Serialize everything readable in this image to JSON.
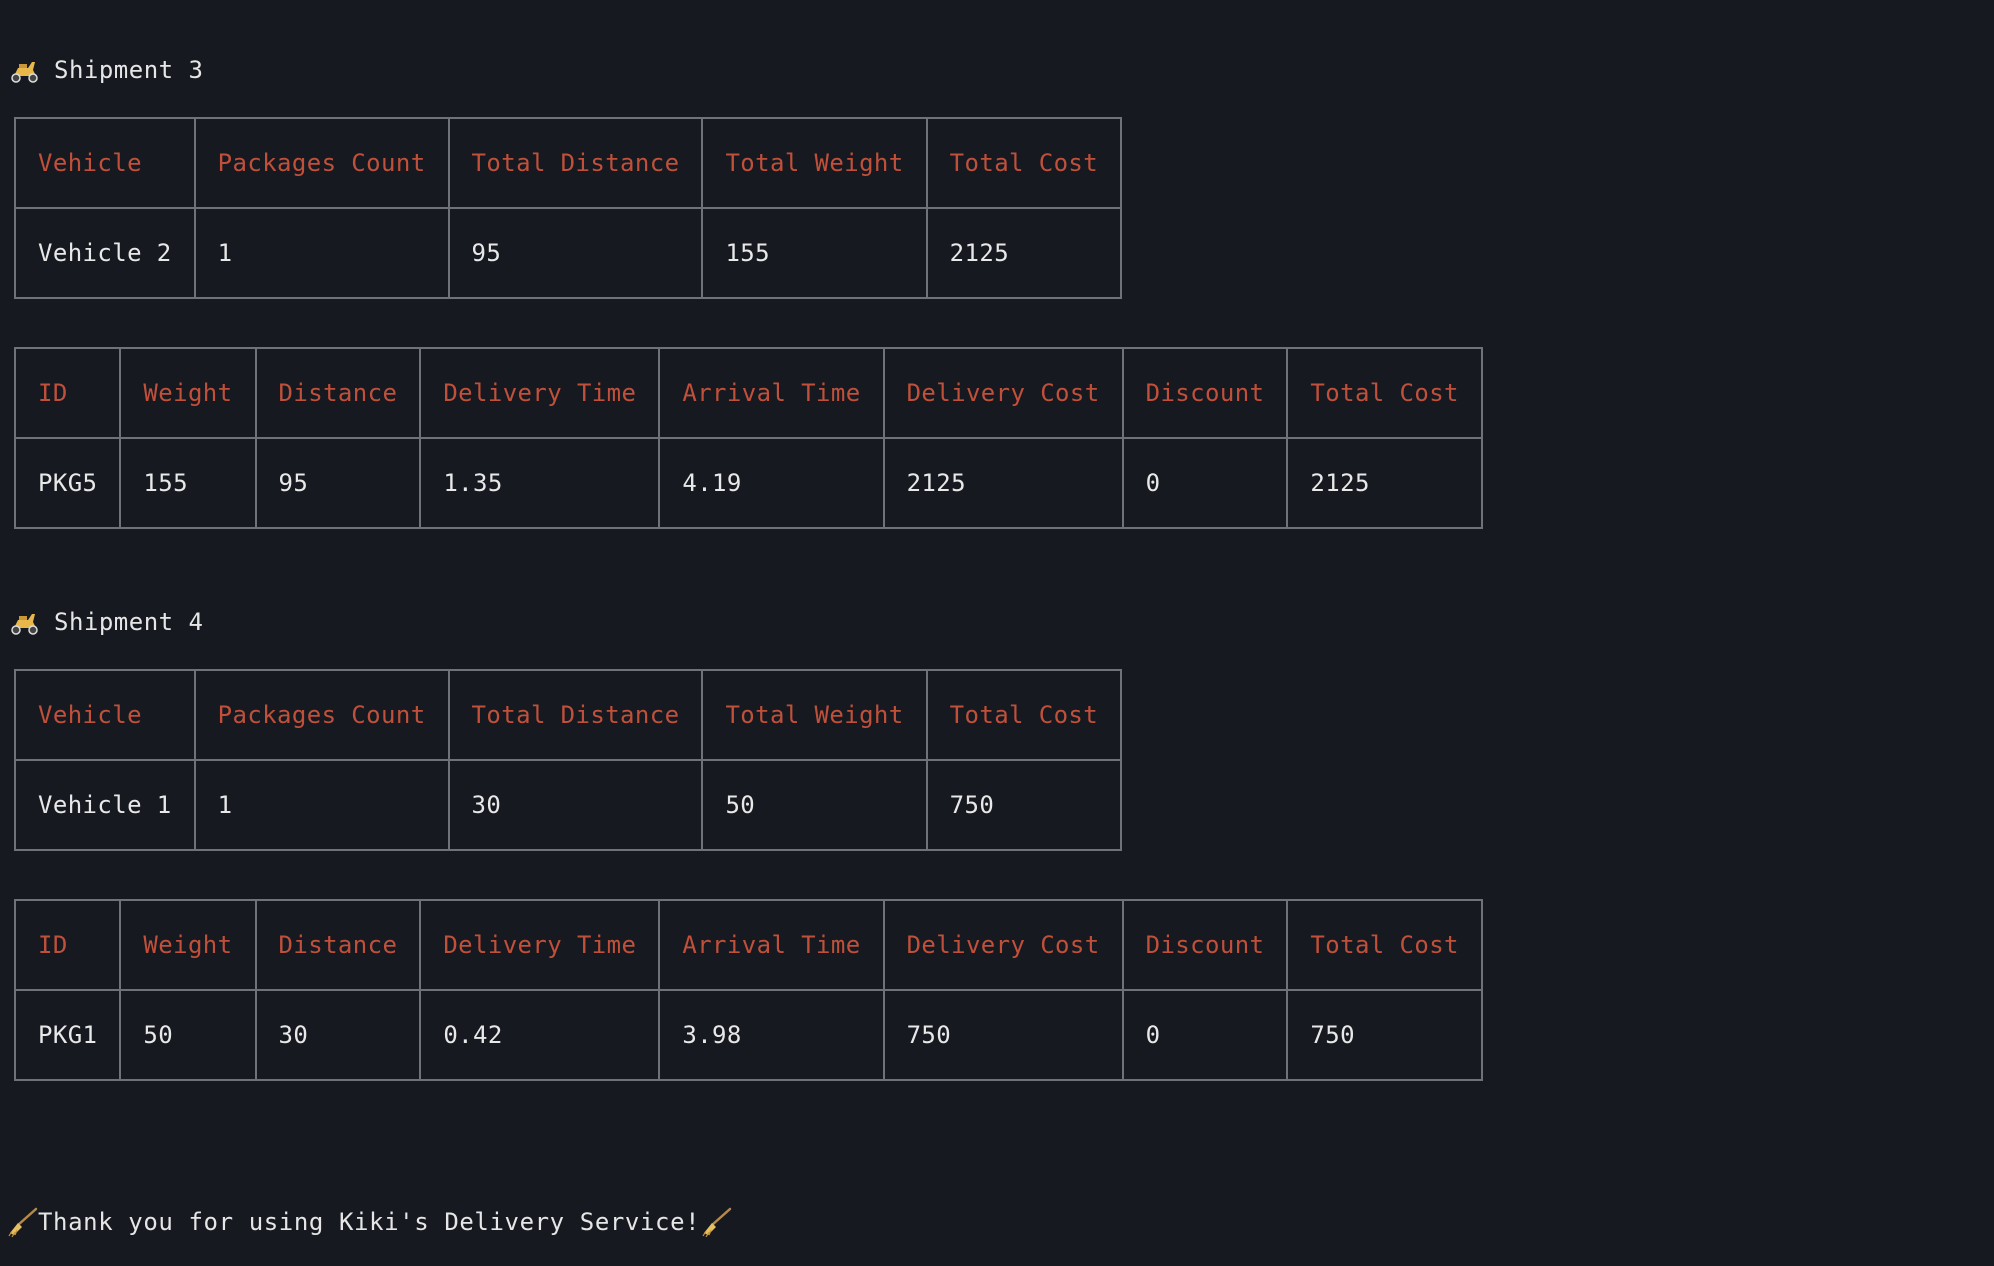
{
  "shipments": [
    {
      "title": "Shipment 3",
      "summary": {
        "headers": [
          "Vehicle",
          "Packages Count",
          "Total Distance",
          "Total Weight",
          "Total Cost"
        ],
        "row": [
          "Vehicle 2",
          "1",
          "95",
          "155",
          "2125"
        ]
      },
      "packages": {
        "headers": [
          "ID",
          "Weight",
          "Distance",
          "Delivery Time",
          "Arrival Time",
          "Delivery Cost",
          "Discount",
          "Total Cost"
        ],
        "rows": [
          [
            "PKG5",
            "155",
            "95",
            "1.35",
            "4.19",
            "2125",
            "0",
            "2125"
          ]
        ]
      }
    },
    {
      "title": "Shipment 4",
      "summary": {
        "headers": [
          "Vehicle",
          "Packages Count",
          "Total Distance",
          "Total Weight",
          "Total Cost"
        ],
        "row": [
          "Vehicle 1",
          "1",
          "30",
          "50",
          "750"
        ]
      },
      "packages": {
        "headers": [
          "ID",
          "Weight",
          "Distance",
          "Delivery Time",
          "Arrival Time",
          "Delivery Cost",
          "Discount",
          "Total Cost"
        ],
        "rows": [
          [
            "PKG1",
            "50",
            "30",
            "0.42",
            "3.98",
            "750",
            "0",
            "750"
          ]
        ]
      }
    }
  ],
  "footer": {
    "message": "Thank you for using Kiki's Delivery Service!"
  },
  "icons": {
    "shipment": "scooter-icon",
    "footer": "broom-icon"
  },
  "colors": {
    "background": "#161920",
    "header_text": "#c0503a",
    "cell_text": "#e8e8e8",
    "border": "#6f7378"
  }
}
